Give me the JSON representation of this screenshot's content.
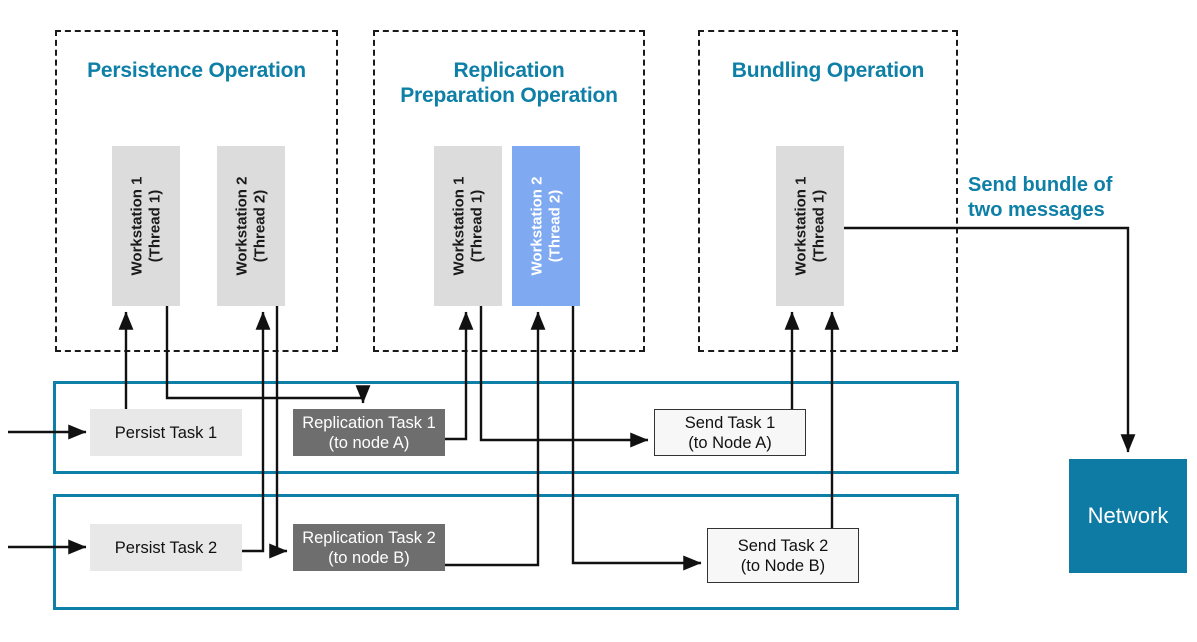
{
  "diagram": {
    "title_color": "#0E7FA6",
    "groups": [
      {
        "id": "persistence",
        "label": "Persistence Operation"
      },
      {
        "id": "replication",
        "label": "Replication\nPreparation Operation",
        "line1": "Replication",
        "line2": "Preparation Operation"
      },
      {
        "id": "bundling",
        "label": "Bundling Operation"
      }
    ],
    "workstations": [
      {
        "id": "persist-ws1",
        "group": "persistence",
        "line1": "Workstation 1",
        "line2": "(Thread 1)",
        "fill": "#DCDCDC",
        "text": "#1a1a1a"
      },
      {
        "id": "persist-ws2",
        "group": "persistence",
        "line1": "Workstation 2",
        "line2": "(Thread 2)",
        "fill": "#DCDCDC",
        "text": "#1a1a1a"
      },
      {
        "id": "replication-ws1",
        "group": "replication",
        "line1": "Workstation 1",
        "line2": "(Thread 1)",
        "fill": "#DCDCDC",
        "text": "#1a1a1a"
      },
      {
        "id": "replication-ws2",
        "group": "replication",
        "line1": "Workstation 2",
        "line2": "(Thread 2)",
        "fill": "#7FA9F0",
        "text": "#ffffff"
      },
      {
        "id": "bundling-ws1",
        "group": "bundling",
        "line1": "Workstation 1",
        "line2": "(Thread 1)",
        "fill": "#DCDCDC",
        "text": "#1a1a1a"
      }
    ],
    "lanes": [
      {
        "id": "lane-1",
        "tasks": [
          {
            "id": "persist-task-1",
            "line1": "Persist Task 1",
            "line2": "",
            "style": "light"
          },
          {
            "id": "replication-task-1",
            "line1": "Replication Task 1",
            "line2": "(to node A)",
            "style": "dark"
          },
          {
            "id": "send-task-1",
            "line1": "Send Task 1",
            "line2": "(to Node A)",
            "style": "outline"
          }
        ]
      },
      {
        "id": "lane-2",
        "tasks": [
          {
            "id": "persist-task-2",
            "line1": "Persist Task 2",
            "line2": "",
            "style": "light"
          },
          {
            "id": "replication-task-2",
            "line1": "Replication Task 2",
            "line2": "(to node B)",
            "style": "dark"
          },
          {
            "id": "send-task-2",
            "line1": "Send Task 2",
            "line2": "(to Node B)",
            "style": "outline"
          }
        ]
      }
    ],
    "annotation": {
      "id": "send-bundle-note",
      "line1": "Send bundle of",
      "line2": "two messages"
    },
    "network": {
      "id": "network-node",
      "label": "Network",
      "fill": "#0E7BA4"
    },
    "colors": {
      "accent_teal": "#0E7FA6",
      "lane_border": "#0E7FA6",
      "task_light": "#E8E8E8",
      "task_dark": "#6E6E6E",
      "task_outline": "#F7F7F7",
      "workstation_grey": "#DCDCDC",
      "workstation_blue": "#7FA9F0",
      "network_fill": "#0E7BA4",
      "connector": "#111111"
    }
  }
}
